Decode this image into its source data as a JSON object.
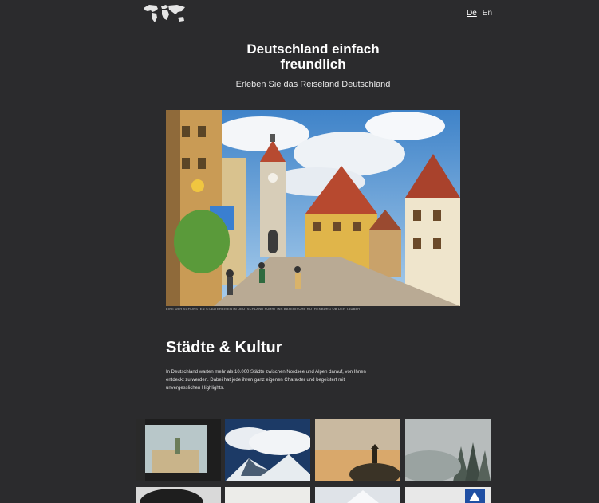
{
  "header": {
    "logo_icon": "world-map-icon",
    "languages": [
      {
        "label": "De",
        "active": true
      },
      {
        "label": "En",
        "active": false
      }
    ]
  },
  "hero": {
    "title": "Deutschland einfach freundlich",
    "subtitle": "Erleben Sie das Reiseland Deutschland"
  },
  "feature_image": {
    "subject": "rothenburg-ob-der-tauber-street",
    "caption": "Eine der schönsten Städtereisen in Deutschland führt ins bayerische Rothenburg ob der Tauber"
  },
  "section": {
    "title": "Städte & Kultur",
    "text": "In Deutschland warten mehr als 10.000 Städte zwischen Nordsee und Alpen darauf, von Ihnen entdeckt zu werden. Dabei hat jede ihren ganz eigenen Charakter und begeistert mit unvergesslichen Highlights."
  },
  "gallery": [
    {
      "subject": "train-window-view"
    },
    {
      "subject": "clouds-over-mountains"
    },
    {
      "subject": "howling-wolf-sunset"
    },
    {
      "subject": "misty-forest"
    },
    {
      "subject": "car-tire"
    },
    {
      "subject": "snowy-scene"
    },
    {
      "subject": "snowy-peak"
    },
    {
      "subject": "road-sign"
    }
  ],
  "colors": {
    "background": "#2b2b2d",
    "text": "#ffffff"
  }
}
